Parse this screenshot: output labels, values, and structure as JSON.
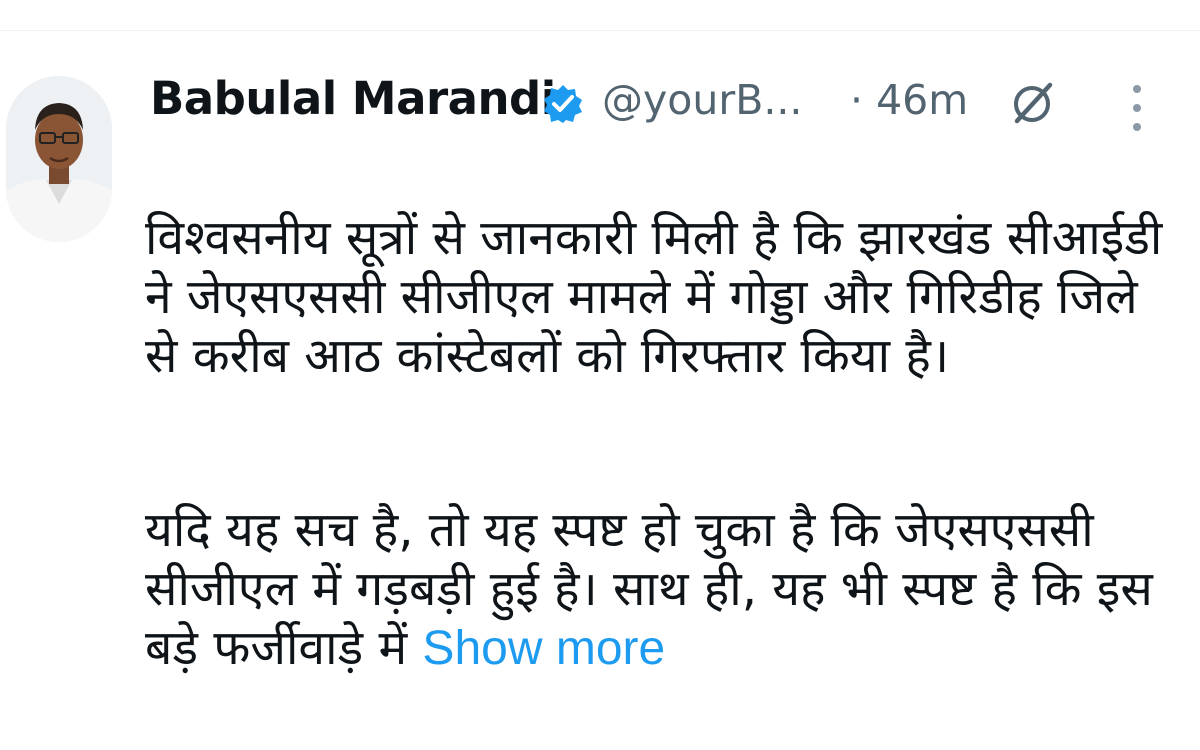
{
  "tweet": {
    "author_name": "Babulal Marandi",
    "handle": "@yourB...",
    "time": "· 46m",
    "verified": true,
    "paragraph1": "विश्वसनीय सूत्रों से जानकारी मिली है कि झारखंड सीआईडी\nने जेएसएससी सीजीएल मामले में गोड्डा और गिरिडीह जिले\nसे करीब आठ कांस्टेबलों को गिरफ्तार किया है।",
    "paragraph2": "यदि यह सच है, तो यह स्पष्ट हो चुका है कि जेएसएससी\nसीजीएल में गड़बड़ी हुई है। साथ ही, यह भी स्पष्ट है कि इस\nबड़े फर्जीवाड़े में ",
    "show_more": "Show more"
  },
  "colors": {
    "accent": "#1d9bf0",
    "secondary_text": "#536471",
    "primary_text": "#0f1419"
  },
  "icons": {
    "verified": "verified-badge-icon",
    "grok": "grok-icon",
    "more": "more-options-icon"
  }
}
